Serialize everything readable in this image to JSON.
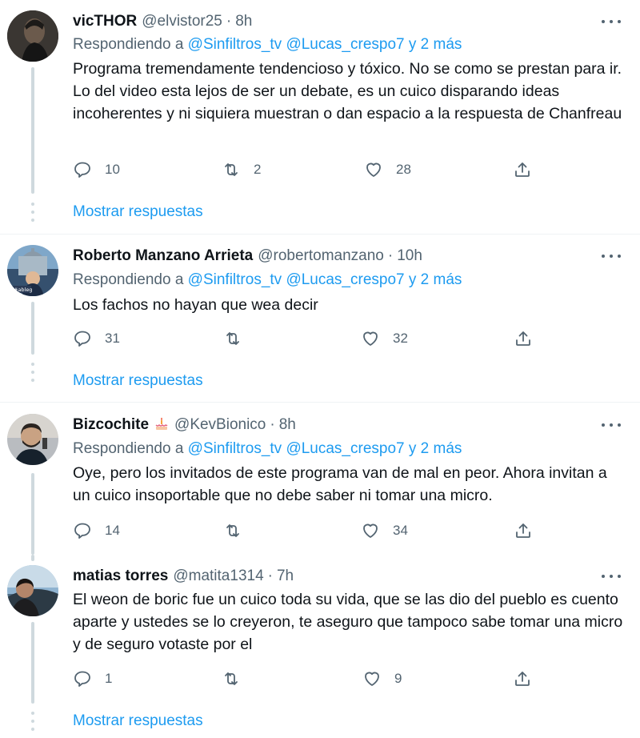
{
  "tweets": [
    {
      "name": "vicTHOR",
      "handle": "@elvistor25",
      "sep": "·",
      "time": "8h",
      "replying_prefix": "Respondiendo a",
      "replying_users": "@Sinfiltros_tv @Lucas_crespo7 y 2 más",
      "text": "Programa tremendamente tendencioso y tóxico. No se como se prestan para ir. Lo del video esta lejos de ser un debate, es un cuico disparando ideas incoherentes y ni siquiera muestran o dan espacio a la respuesta de Chanfreau",
      "replies": "10",
      "retweets": "2",
      "likes": "28",
      "show_replies": "Mostrar respuestas"
    },
    {
      "name": "Roberto Manzano Arrieta",
      "handle": "@robertomanzano",
      "sep": "·",
      "time": "10h",
      "replying_prefix": "Respondiendo a",
      "replying_users": "@Sinfiltros_tv @Lucas_crespo7 y 2 más",
      "text": "Los fachos no hayan que wea decir",
      "replies": "31",
      "retweets": "",
      "likes": "32",
      "show_replies": "Mostrar respuestas",
      "avatar_label": "#ableg"
    },
    {
      "name": "Bizcochite",
      "handle": "@KevBionico",
      "sep": "·",
      "time": "8h",
      "replying_prefix": "Respondiendo a",
      "replying_users": "@Sinfiltros_tv @Lucas_crespo7 y 2 más",
      "text": "Oye, pero los invitados de este programa van de mal en peor. Ahora invitan a un cuico insoportable que no debe saber ni tomar una micro.",
      "replies": "14",
      "retweets": "",
      "likes": "34"
    },
    {
      "name": "matias torres",
      "handle": "@matita1314",
      "sep": "·",
      "time": "7h",
      "text": "El weon de boric fue un cuico toda su vida, que se las dio del pueblo es cuento aparte y ustedes se lo creyeron, te aseguro que tampoco sabe tomar una micro y de seguro votaste por el",
      "replies": "1",
      "retweets": "",
      "likes": "9",
      "show_replies": "Mostrar respuestas"
    }
  ],
  "icons": {
    "reply": "reply-icon",
    "retweet": "retweet-icon",
    "like": "heart-icon",
    "share": "share-icon",
    "more": "more-icon",
    "cake": "birthday-cake-icon"
  },
  "colors": {
    "link": "#1d9bf0",
    "secondary": "#536471",
    "primary_text": "#0f1419",
    "thread_line": "#cfd9de"
  }
}
